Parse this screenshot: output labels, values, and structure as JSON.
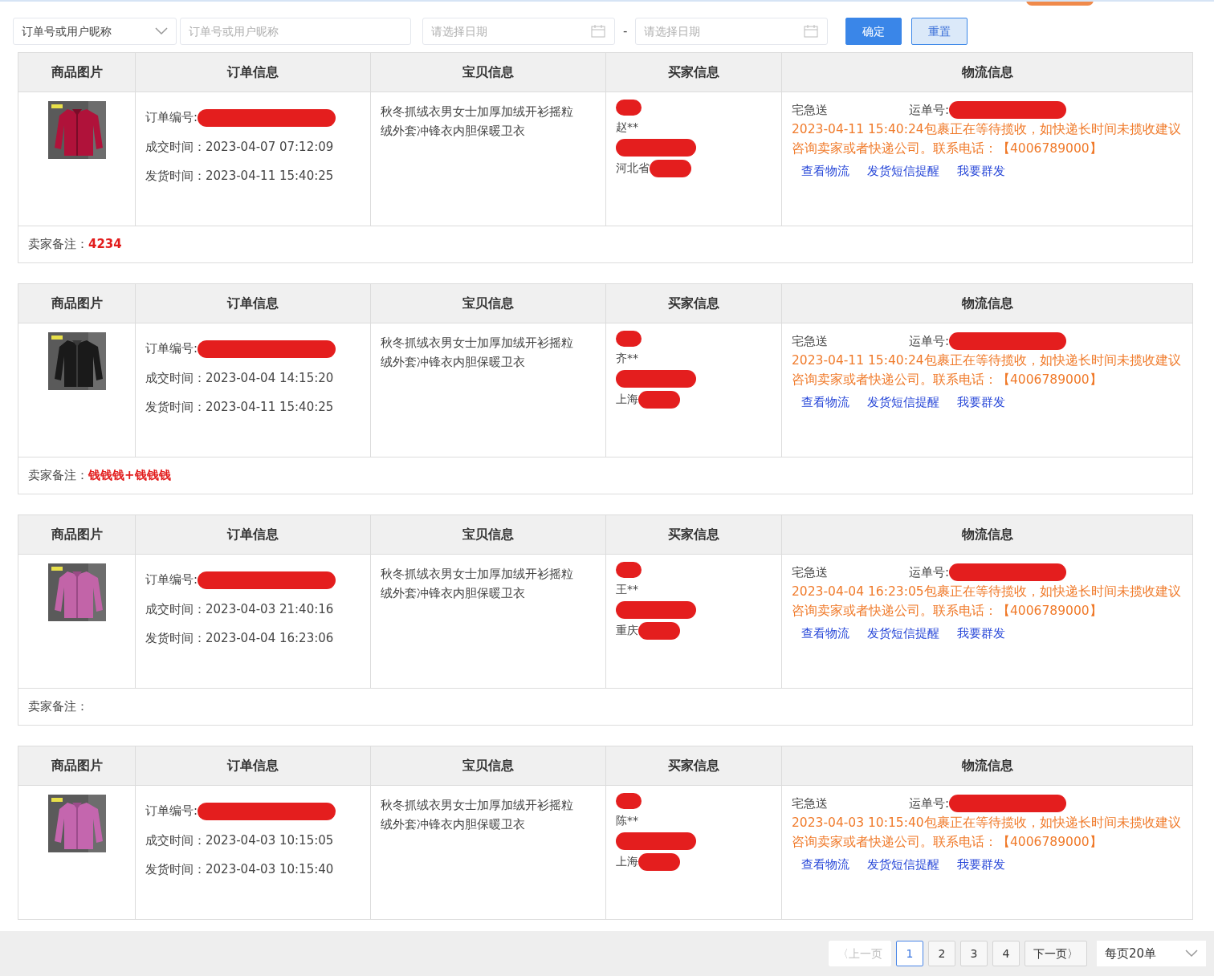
{
  "filters": {
    "search_type": {
      "value": "订单号或用户昵称"
    },
    "keyword": {
      "placeholder": "订单号或用户昵称"
    },
    "date_from": {
      "placeholder": "请选择日期"
    },
    "date_separator": "-",
    "date_to": {
      "placeholder": "请选择日期"
    },
    "buttons": [
      {
        "label": "确定",
        "kind": "primary"
      },
      {
        "label": "重置",
        "kind": "secondary"
      }
    ]
  },
  "orders": [
    {
      "columns": [
        "商品图片",
        "订单信息",
        "宝贝信息",
        "买家信息",
        "物流信息"
      ],
      "order_no_label": "订单编号:",
      "deal_time": "成交时间：2023-04-07 07:12:09",
      "ship_time": "发货时间：2023-04-11 15:40:25",
      "item_title": "秋冬抓绒衣男女士加厚加绒开衫摇粒绒外套冲锋衣内胆保暖卫衣",
      "buyer": {
        "name": "赵**",
        "region": "河北省"
      },
      "logistics": {
        "carrier": "宅急送",
        "waybill_label": "运单号:",
        "status": "2023-04-11 15:40:24包裹正在等待揽收，如快递长时间未揽收建议咨询卖家或者快递公司。联系电话：【4006789000】",
        "actions": [
          "查看物流",
          "发货短信提醒",
          "我要群发"
        ]
      },
      "remark": {
        "label": "卖家备注：",
        "value": "4234"
      }
    },
    {
      "columns": [
        "商品图片",
        "订单信息",
        "宝贝信息",
        "买家信息",
        "物流信息"
      ],
      "order_no_label": "订单编号:",
      "deal_time": "成交时间：2023-04-04 14:15:20",
      "ship_time": "发货时间：2023-04-11 15:40:25",
      "item_title": "秋冬抓绒衣男女士加厚加绒开衫摇粒绒外套冲锋衣内胆保暖卫衣",
      "buyer": {
        "name": "齐**",
        "region": "上海"
      },
      "logistics": {
        "carrier": "宅急送",
        "waybill_label": "运单号:",
        "status": "2023-04-11 15:40:24包裹正在等待揽收，如快递长时间未揽收建议咨询卖家或者快递公司。联系电话：【4006789000】",
        "actions": [
          "查看物流",
          "发货短信提醒",
          "我要群发"
        ]
      },
      "remark": {
        "label": "卖家备注：",
        "value": "钱钱钱+钱钱钱"
      }
    },
    {
      "columns": [
        "商品图片",
        "订单信息",
        "宝贝信息",
        "买家信息",
        "物流信息"
      ],
      "order_no_label": "订单编号:",
      "deal_time": "成交时间：2023-04-03 21:40:16",
      "ship_time": "发货时间：2023-04-04 16:23:06",
      "item_title": "秋冬抓绒衣男女士加厚加绒开衫摇粒绒外套冲锋衣内胆保暖卫衣",
      "buyer": {
        "name": "王**",
        "region": "重庆"
      },
      "logistics": {
        "carrier": "宅急送",
        "waybill_label": "运单号:",
        "status": "2023-04-04 16:23:05包裹正在等待揽收，如快递长时间未揽收建议咨询卖家或者快递公司。联系电话：【4006789000】",
        "actions": [
          "查看物流",
          "发货短信提醒",
          "我要群发"
        ]
      },
      "remark": {
        "label": "卖家备注："
      }
    },
    {
      "columns": [
        "商品图片",
        "订单信息",
        "宝贝信息",
        "买家信息",
        "物流信息"
      ],
      "order_no_label": "订单编号:",
      "deal_time": "成交时间：2023-04-03 10:15:05",
      "ship_time": "发货时间：2023-04-03 10:15:40",
      "item_title": "秋冬抓绒衣男女士加厚加绒开衫摇粒绒外套冲锋衣内胆保暖卫衣",
      "buyer": {
        "name": "陈**",
        "region": "上海"
      },
      "logistics": {
        "carrier": "宅急送",
        "waybill_label": "运单号:",
        "status": "2023-04-03 10:15:40包裹正在等待揽收，如快递长时间未揽收建议咨询卖家或者快递公司。联系电话：【4006789000】",
        "actions": [
          "查看物流",
          "发货短信提醒",
          "我要群发"
        ]
      }
    }
  ],
  "pagination": {
    "prev": {
      "label": "〈上一页",
      "disabled": true
    },
    "pages": [
      {
        "label": "1",
        "selected": true
      },
      {
        "label": "2",
        "selected": false
      },
      {
        "label": "3",
        "selected": false
      },
      {
        "label": "4",
        "selected": false
      }
    ],
    "next": {
      "label": "下一页〉",
      "disabled": false
    },
    "page_size": {
      "value": "每页20单"
    }
  }
}
